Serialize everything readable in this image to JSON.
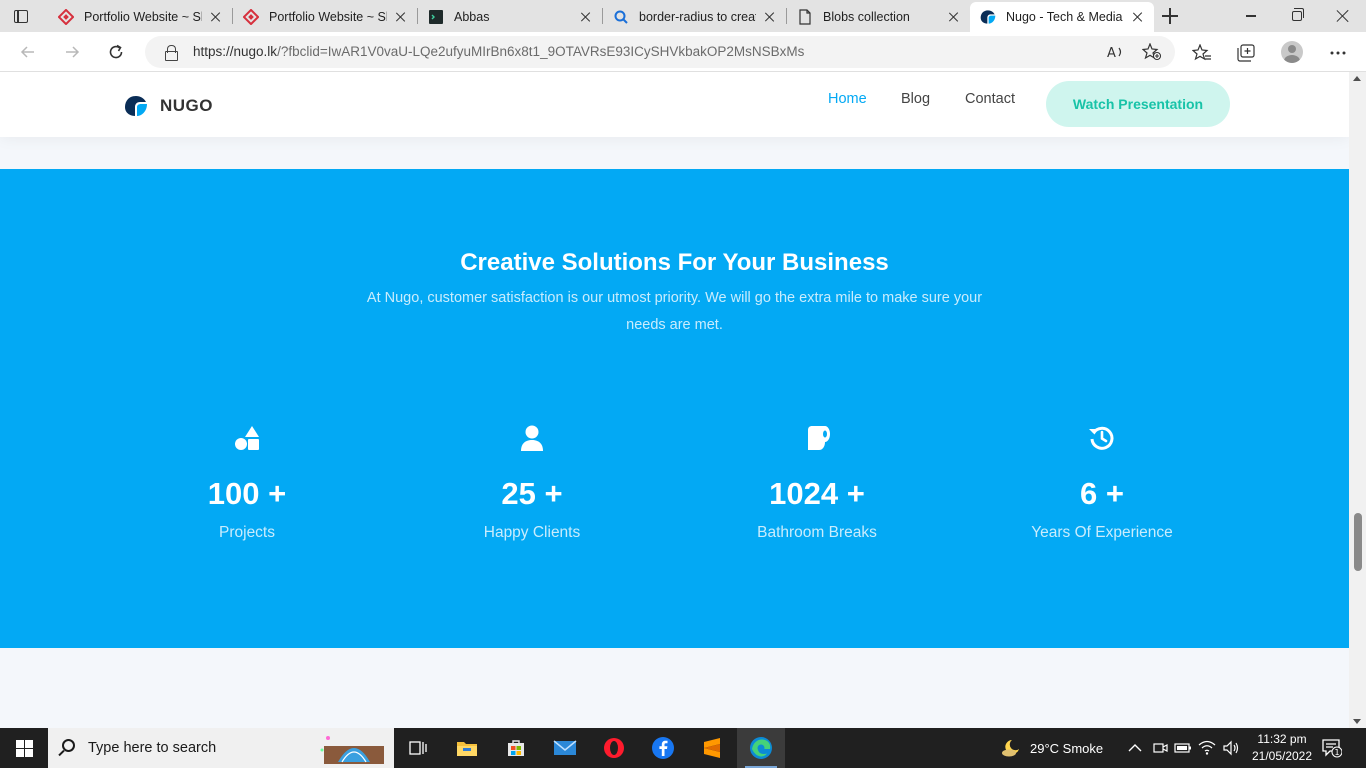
{
  "browser": {
    "tabs": [
      {
        "title": "Portfolio Website ~ Sh",
        "icon": "shopify-diamond-icon",
        "active": false
      },
      {
        "title": "Portfolio Website ~ Sh",
        "icon": "shopify-diamond-icon",
        "active": false
      },
      {
        "title": "Abbas",
        "icon": "terminal-icon",
        "active": false
      },
      {
        "title": "border-radius to creat",
        "icon": "search-icon",
        "active": false
      },
      {
        "title": "Blobs collection",
        "icon": "document-icon",
        "active": false
      },
      {
        "title": "Nugo - Tech & Media",
        "icon": "nugo-logo-icon",
        "active": true
      }
    ],
    "url_main": "https://nugo.lk",
    "url_rest": "/?fbclid=IwAR1V0vaU-LQe2ufyuMIrBn6x8t1_9OTAVRsE93ICySHVkbakOP2MsNSBxMs"
  },
  "site": {
    "brand": "NUGO",
    "nav": [
      {
        "label": "Home",
        "active": true
      },
      {
        "label": "Blog",
        "active": false
      },
      {
        "label": "Contact",
        "active": false
      }
    ],
    "cta_label": "Watch Presentation",
    "hero": {
      "title": "Creative Solutions For Your Business",
      "subtitle": "At Nugo, customer satisfaction is our utmost priority. We will go the extra mile to make sure your needs are met."
    },
    "stats": [
      {
        "value": "100 +",
        "label": "Projects",
        "icon": "shapes-icon"
      },
      {
        "value": "25 +",
        "label": "Happy Clients",
        "icon": "user-icon"
      },
      {
        "value": "1024 +",
        "label": "Bathroom Breaks",
        "icon": "toilet-paper-icon"
      },
      {
        "value": "6 +",
        "label": "Years Of Experience",
        "icon": "history-icon"
      }
    ]
  },
  "taskbar": {
    "search_placeholder": "Type here to search",
    "weather": "29°C  Smoke",
    "time": "11:32 pm",
    "date": "21/05/2022",
    "notification_count": "1"
  },
  "colors": {
    "accent": "#03a9f4",
    "cta_bg": "#cff5ee",
    "cta_text": "#18c3a8"
  }
}
